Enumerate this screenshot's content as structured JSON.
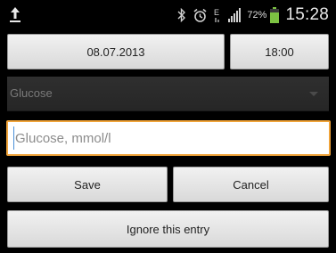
{
  "status_bar": {
    "battery_percent": "72%",
    "time": "15:28",
    "icons": [
      "upload-icon",
      "bluetooth-icon",
      "alarm-icon",
      "network-e-icon",
      "signal-icon",
      "battery-icon"
    ],
    "battery_color": "#7cc242"
  },
  "form": {
    "date": "08.07.2013",
    "time": "18:00",
    "measurement_type": "Glucose",
    "value_placeholder": "Glucose, mmol/l",
    "value": ""
  },
  "actions": {
    "save": "Save",
    "cancel": "Cancel",
    "ignore": "Ignore this entry"
  },
  "colors": {
    "input_focus_border": "#f0a43a",
    "background": "#000000"
  }
}
